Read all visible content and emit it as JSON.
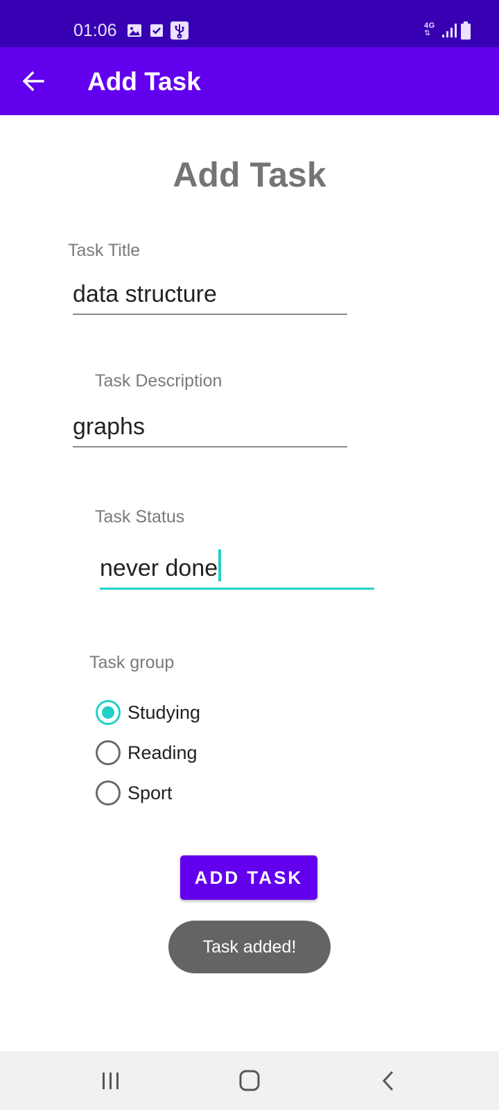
{
  "status_bar": {
    "time": "01:06",
    "icons_left": [
      "image-icon",
      "checkbox-icon",
      "usb-icon"
    ],
    "icons_right": [
      "4g-data-icon",
      "signal-icon",
      "battery-icon"
    ],
    "network_label": "4G"
  },
  "app_bar": {
    "title": "Add Task",
    "back_icon": "arrow-left-icon"
  },
  "form": {
    "heading": "Add Task",
    "title_label": "Task Title",
    "title_value": "data structure",
    "description_label": "Task Description",
    "description_value": "graphs",
    "status_label": "Task Status",
    "status_value": "never done",
    "group_label": "Task group",
    "group_options": [
      {
        "label": "Studying",
        "checked": true
      },
      {
        "label": "Reading",
        "checked": false
      },
      {
        "label": "Sport",
        "checked": false
      }
    ],
    "submit_label": "ADD TASK"
  },
  "toast": {
    "message": "Task added!"
  },
  "nav_bar": {
    "buttons": [
      "recent-apps-icon",
      "home-icon",
      "back-icon"
    ]
  },
  "colors": {
    "status_bar": "#3700b3",
    "primary": "#6200ee",
    "accent": "#1fd1c8",
    "toast": "#646464",
    "nav_bar": "#f1f1f1"
  }
}
